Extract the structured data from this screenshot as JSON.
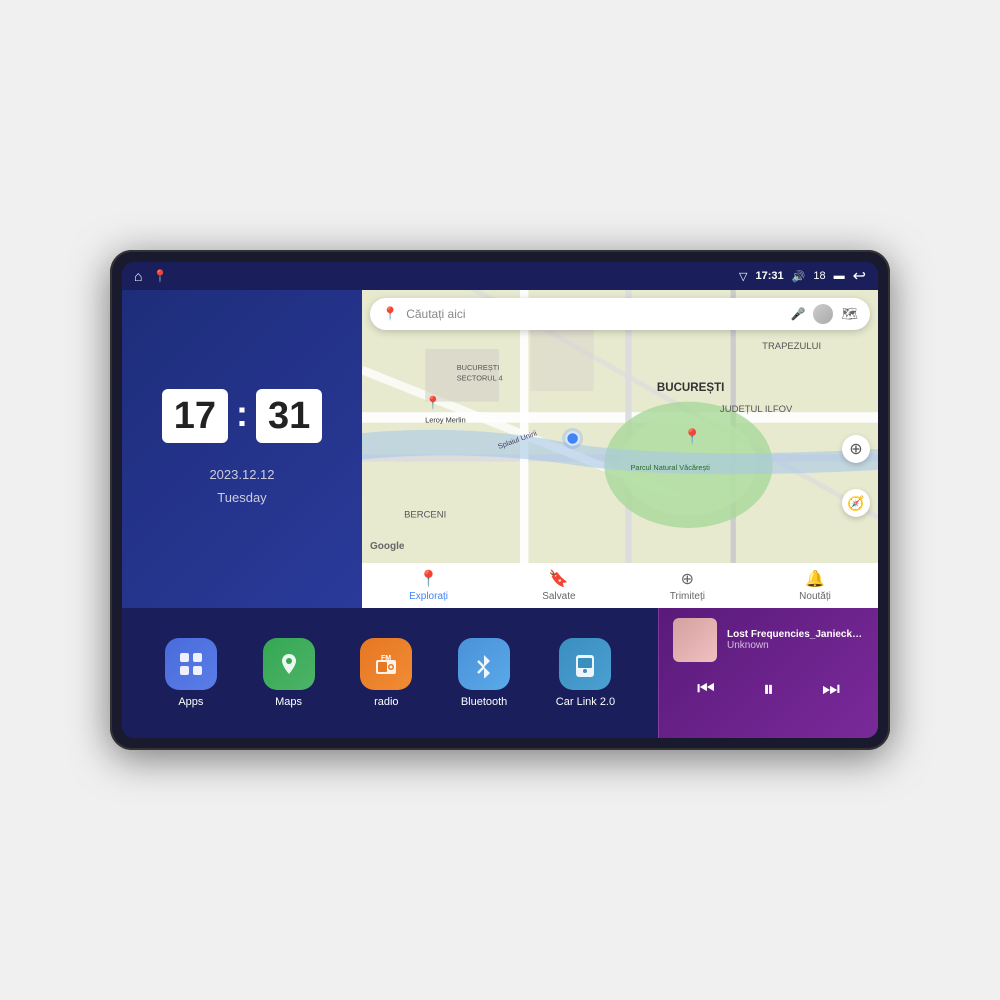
{
  "device": {
    "screen": {
      "statusBar": {
        "leftIcons": [
          "home-icon",
          "maps-icon"
        ],
        "signal": "▽",
        "time": "17:31",
        "volume": "🔊",
        "volumeLevel": "18",
        "battery": "▬",
        "back": "↩"
      }
    }
  },
  "clock": {
    "hours": "17",
    "minutes": "31",
    "date": "2023.12.12",
    "day": "Tuesday"
  },
  "map": {
    "searchPlaceholder": "Căutați aici",
    "navItems": [
      {
        "icon": "📍",
        "label": "Explorați",
        "active": true
      },
      {
        "icon": "🔖",
        "label": "Salvate",
        "active": false
      },
      {
        "icon": "⊕",
        "label": "Trimiteți",
        "active": false
      },
      {
        "icon": "🔔",
        "label": "Noutăți",
        "active": false
      }
    ],
    "labels": [
      "BUCUREȘTI",
      "JUDEȚUL ILFOV",
      "TRAPEZULUI",
      "BERCENI",
      "Parcul Natural Văcărești",
      "Leroy Merlin",
      "BUCUREȘTI SECTORUL 4",
      "Splaiul Unirii"
    ]
  },
  "apps": [
    {
      "id": "apps",
      "label": "Apps",
      "icon": "⊞",
      "colorClass": "icon-apps"
    },
    {
      "id": "maps",
      "label": "Maps",
      "icon": "📍",
      "colorClass": "icon-maps"
    },
    {
      "id": "radio",
      "label": "radio",
      "icon": "📻",
      "colorClass": "icon-radio"
    },
    {
      "id": "bluetooth",
      "label": "Bluetooth",
      "icon": "🔷",
      "colorClass": "icon-bluetooth"
    },
    {
      "id": "carlink",
      "label": "Car Link 2.0",
      "icon": "📱",
      "colorClass": "icon-carlink"
    }
  ],
  "music": {
    "title": "Lost Frequencies_Janieck Devy-...",
    "artist": "Unknown",
    "controls": {
      "prev": "⏮",
      "play": "⏸",
      "next": "⏭"
    }
  }
}
